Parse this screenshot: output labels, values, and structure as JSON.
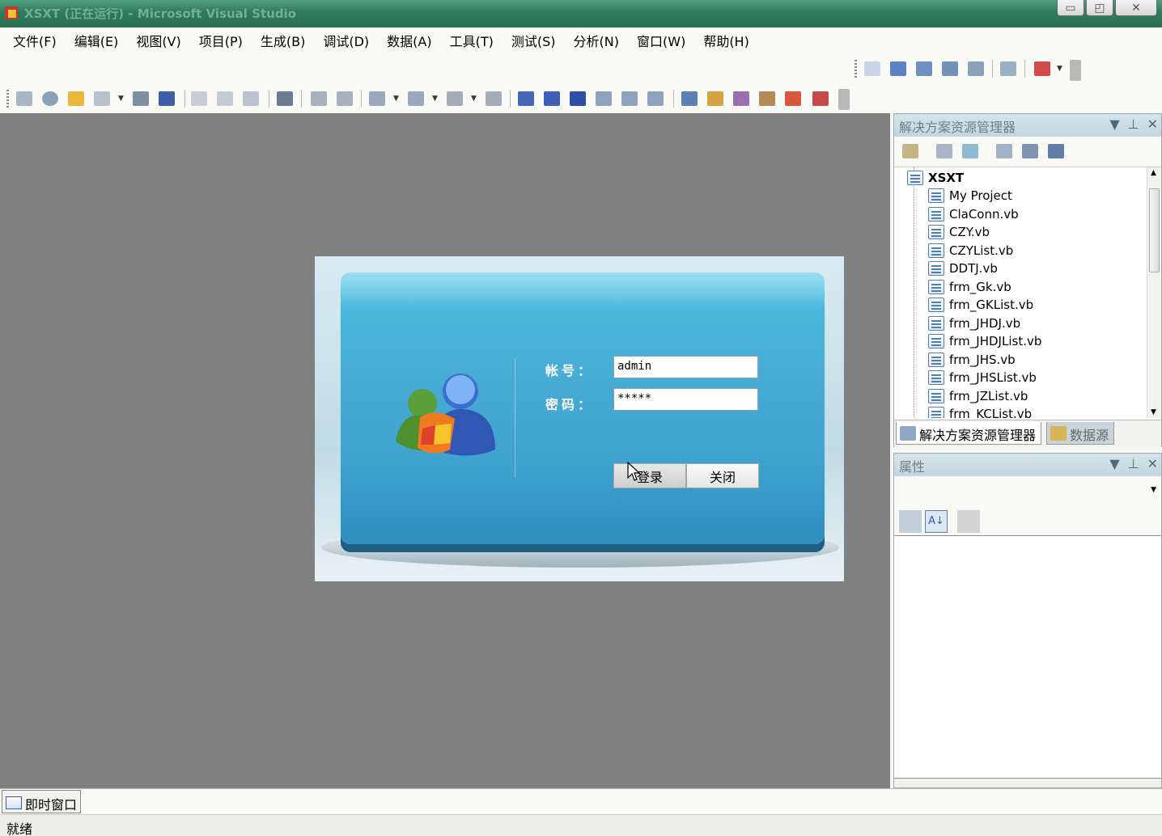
{
  "window": {
    "title": "XSXT (正在运行) - Microsoft Visual Studio"
  },
  "menu": [
    "文件(F)",
    "编辑(E)",
    "视图(V)",
    "项目(P)",
    "生成(B)",
    "调试(D)",
    "数据(A)",
    "工具(T)",
    "测试(S)",
    "分析(N)",
    "窗口(W)",
    "帮助(H)"
  ],
  "login": {
    "account_label": "帐号：",
    "account_value": "admin",
    "password_label": "密码：",
    "password_value": "*****",
    "login_button": "登录",
    "close_button": "关闭"
  },
  "solution_explorer": {
    "title": "解决方案资源管理器",
    "root": "XSXT",
    "items": [
      "My Project",
      "ClaConn.vb",
      "CZY.vb",
      "CZYList.vb",
      "DDTJ.vb",
      "frm_Gk.vb",
      "frm_GKList.vb",
      "frm_JHDJ.vb",
      "frm_JHDJList.vb",
      "frm_JHS.vb",
      "frm_JHSList.vb",
      "frm_JZList.vb",
      "frm_KCList.vb"
    ],
    "tabs": [
      "解决方案资源管理器",
      "数据源"
    ]
  },
  "properties": {
    "title": "属性"
  },
  "bottom": {
    "immediate_tab": "即时窗口",
    "status": "就绪"
  }
}
